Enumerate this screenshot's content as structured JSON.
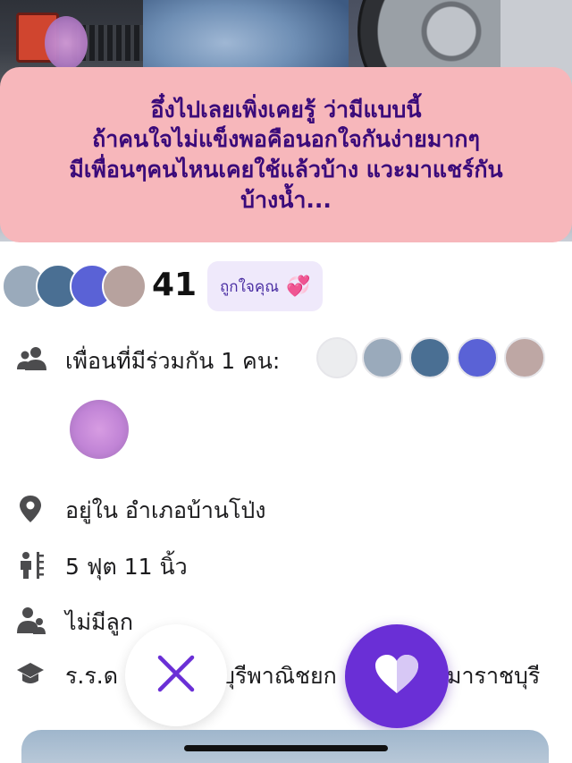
{
  "banner": {
    "caption": "อึ๋งไปเลยเพิ่งเคยรู้ ว่ามีแบบนี้\nถ้าคนใจไม่แข็งพอคือนอกใจกันง่ายมากๆ\nมีเพื่อนๆคนไหนเคยใช้แล้วบ้าง แวะมาแชร์กัน\nบ้างน้ำ..."
  },
  "likes": {
    "count": "41",
    "liked_you_label": "ถูกใจคุณ",
    "heart_glyph": "💞"
  },
  "profile": {
    "mutual_friends_label": "เพื่อนที่มีร่วมกัน 1 คน:",
    "location": "อยู่ใน อำเภอบ้านโป่ง",
    "height": "5 ฟุต 11 นิ้ว",
    "children": "ไม่มีลูก",
    "education_left": "ร.ร.ด",
    "education_right": "บุรีพาณิชยก",
    "education_tail": "มาราชบุรี"
  },
  "colors": {
    "banner_bg": "#f7b7bb",
    "banner_text": "#3a0a7a",
    "accent": "#6a2fd6",
    "liked_badge_bg": "#efe9fb"
  },
  "icons": {
    "mutual": "people-icon",
    "location": "location-pin-icon",
    "height": "height-ruler-icon",
    "children": "children-icon",
    "education": "graduation-cap-icon",
    "dislike": "close-icon",
    "like": "heart-icon"
  }
}
